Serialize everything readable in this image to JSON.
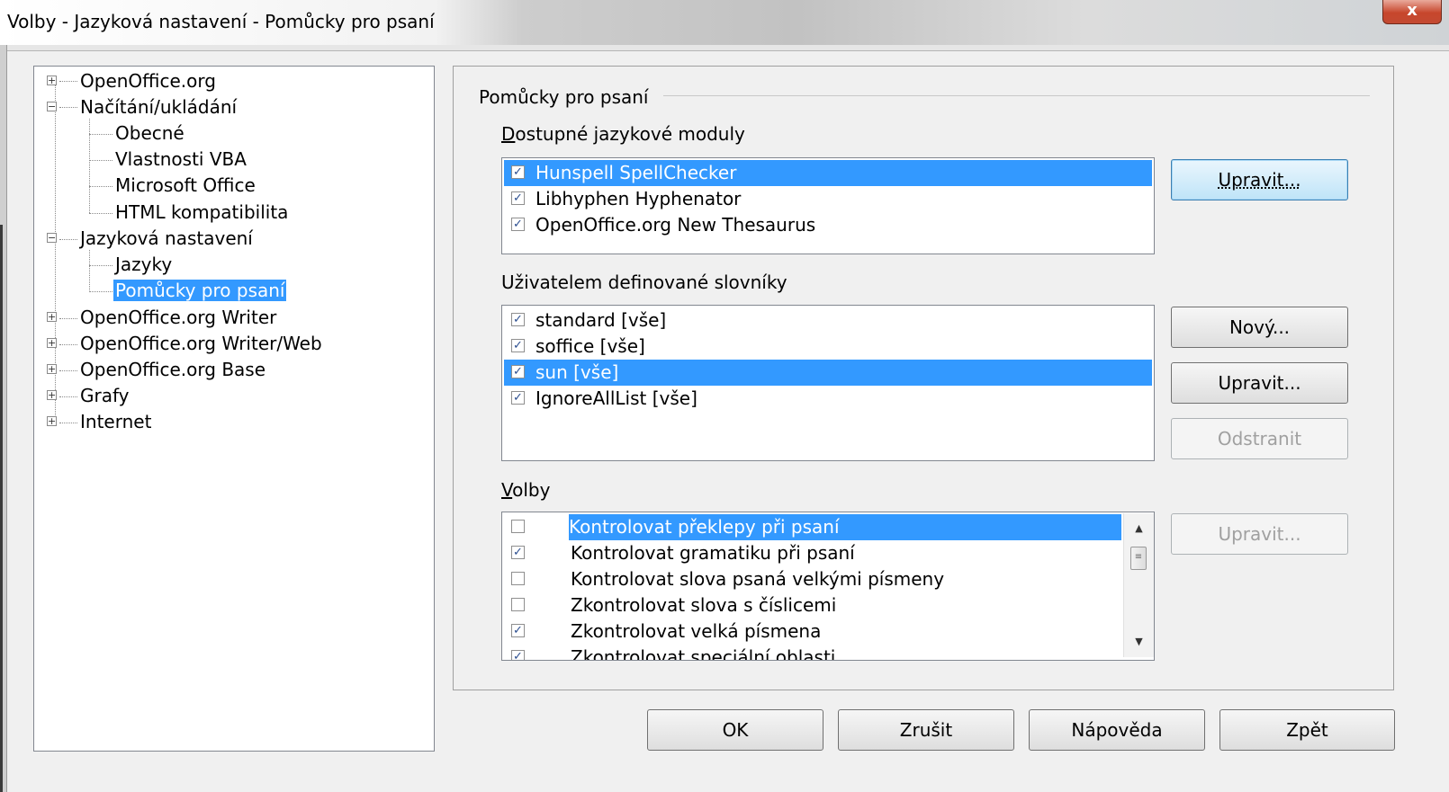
{
  "window": {
    "title": "Volby - Jazyková nastavení - Pomůcky pro psaní",
    "close_label": "x"
  },
  "tree": {
    "items": [
      {
        "label": "OpenOffice.org",
        "expander": "+"
      },
      {
        "label": "Načítání/ukládání",
        "expander": "−"
      },
      {
        "label": "Obecné"
      },
      {
        "label": "Vlastnosti VBA"
      },
      {
        "label": "Microsoft Office"
      },
      {
        "label": "HTML kompatibilita"
      },
      {
        "label": "Jazyková nastavení",
        "expander": "−"
      },
      {
        "label": "Jazyky"
      },
      {
        "label": "Pomůcky pro psaní",
        "selected": true
      },
      {
        "label": "OpenOffice.org Writer",
        "expander": "+"
      },
      {
        "label": "OpenOffice.org Writer/Web",
        "expander": "+"
      },
      {
        "label": "OpenOffice.org Base",
        "expander": "+"
      },
      {
        "label": "Grafy",
        "expander": "+"
      },
      {
        "label": "Internet",
        "expander": "+"
      }
    ]
  },
  "panel": {
    "group_title": "Pomůcky pro psaní",
    "modules": {
      "label": "Dostupné jazykové moduly",
      "items": [
        {
          "label": "Hunspell SpellChecker",
          "checked": true,
          "selected": true
        },
        {
          "label": "Libhyphen Hyphenator",
          "checked": true
        },
        {
          "label": "OpenOffice.org New Thesaurus",
          "checked": true
        }
      ],
      "edit_button": "Upravit..."
    },
    "dictionaries": {
      "label": "Uživatelem definované slovníky",
      "items": [
        {
          "label": "standard [vše]",
          "checked": true
        },
        {
          "label": "soffice [vše]",
          "checked": true
        },
        {
          "label": "sun [vše]",
          "checked": true,
          "selected": true
        },
        {
          "label": "IgnoreAllList [vše]",
          "checked": true
        }
      ],
      "new_button": "Nový...",
      "edit_button": "Upravit...",
      "delete_button": "Odstranit"
    },
    "options": {
      "label": "Volby",
      "items": [
        {
          "label": "Kontrolovat překlepy při psaní",
          "checked": false,
          "selected": true
        },
        {
          "label": "Kontrolovat gramatiku při psaní",
          "checked": true
        },
        {
          "label": "Kontrolovat slova psaná velkými písmeny",
          "checked": false
        },
        {
          "label": "Zkontrolovat slova s číslicemi",
          "checked": false
        },
        {
          "label": "Zkontrolovat velká písmena",
          "checked": true
        },
        {
          "label": "Zkontrolovat speciální oblasti",
          "checked": true
        }
      ],
      "edit_button": "Upravit..."
    }
  },
  "buttons": {
    "ok": "OK",
    "cancel": "Zrušit",
    "help": "Nápověda",
    "back": "Zpět"
  },
  "colors": {
    "selection": "#3399ff",
    "panel_bg": "#f0f0f0"
  }
}
